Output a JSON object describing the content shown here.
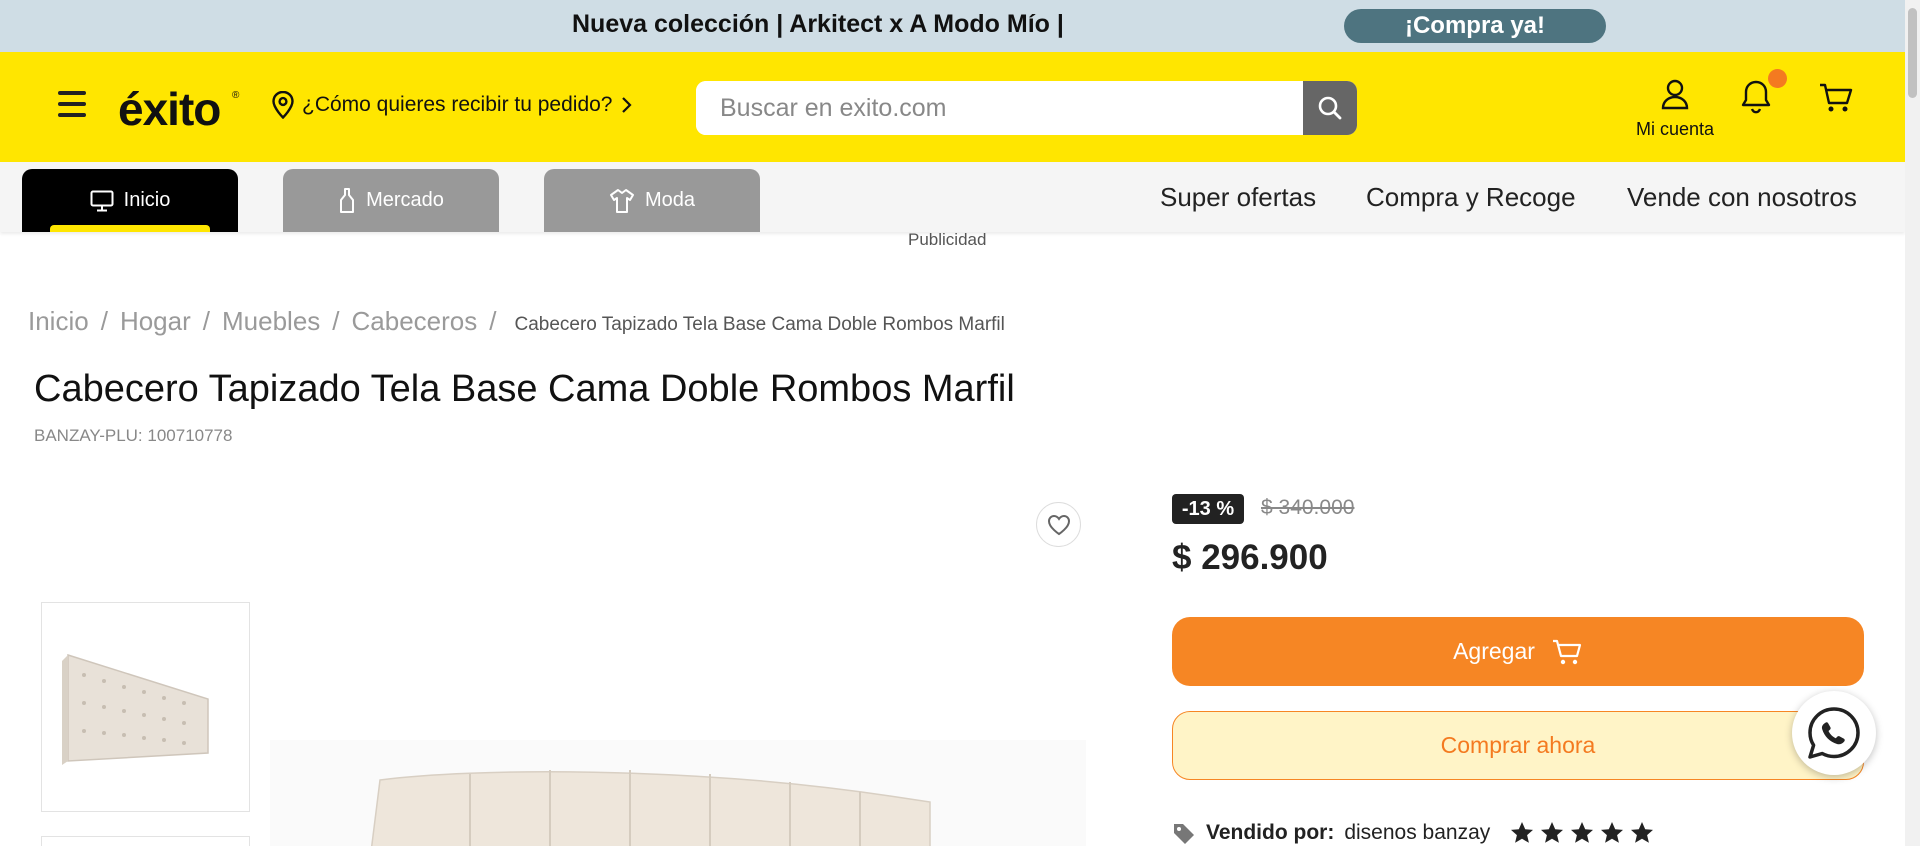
{
  "promo": {
    "text": "Nueva colección | Arkitect x A Modo Mío |",
    "cta": "¡Compra ya!"
  },
  "header": {
    "logo": "éxito",
    "logo_mark": "®",
    "delivery_prompt": "¿Cómo quieres recibir tu pedido?",
    "search_placeholder": "Buscar en exito.com",
    "account_label": "Mi cuenta",
    "notification_badge_color": "#f47a20"
  },
  "nav": {
    "tabs": [
      {
        "label": "Inicio",
        "icon": "monitor-icon",
        "active": true
      },
      {
        "label": "Mercado",
        "icon": "bottle-icon",
        "active": false
      },
      {
        "label": "Moda",
        "icon": "shirt-icon",
        "active": false
      }
    ],
    "links": [
      "Super ofertas",
      "Compra y Recoge",
      "Vende con nosotros"
    ]
  },
  "ad_label": "Publicidad",
  "breadcrumb": {
    "items": [
      "Inicio",
      "Hogar",
      "Muebles",
      "Cabeceros"
    ],
    "separator": "/",
    "current": "Cabecero Tapizado Tela Base Cama Doble Rombos Marfil"
  },
  "product": {
    "title": "Cabecero Tapizado Tela Base Cama Doble Rombos Marfil",
    "sku": "BANZAY-PLU: 100710778",
    "discount": "-13 %",
    "old_price": "$ 340.000",
    "price": "$ 296.900",
    "add_button": "Agregar",
    "buy_button": "Comprar ahora",
    "seller_label": "Vendido por:",
    "seller_name": "disenos banzay",
    "rating": 5
  },
  "colors": {
    "brand_yellow": "#ffe600",
    "accent_orange": "#f68624",
    "promo_bg": "#cfdde5",
    "promo_button": "#4e7480"
  }
}
